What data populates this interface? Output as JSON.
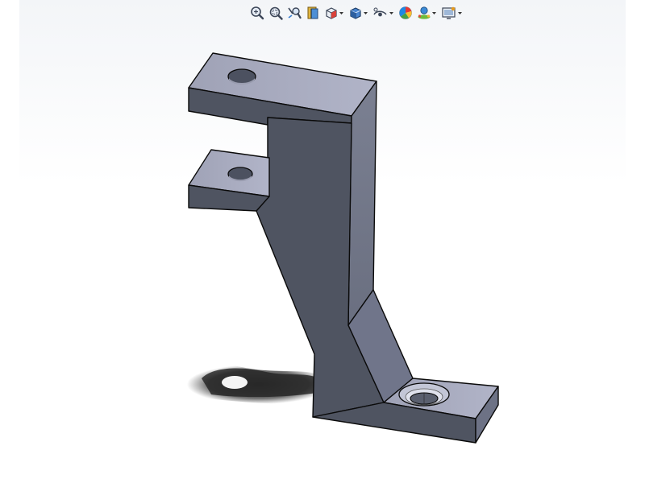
{
  "toolbar": {
    "tools": [
      {
        "icon": "zoom-to-fit-icon",
        "has_dropdown": false
      },
      {
        "icon": "zoom-to-area-icon",
        "has_dropdown": false
      },
      {
        "icon": "previous-view-icon",
        "has_dropdown": false
      },
      {
        "icon": "section-view-icon",
        "has_dropdown": false
      },
      {
        "icon": "view-orientation-icon",
        "has_dropdown": true
      },
      {
        "icon": "display-style-icon",
        "has_dropdown": true
      },
      {
        "icon": "hide-show-items-icon",
        "has_dropdown": true
      },
      {
        "icon": "edit-appearance-icon",
        "has_dropdown": false
      },
      {
        "icon": "apply-scene-icon",
        "has_dropdown": true
      },
      {
        "icon": "view-settings-icon",
        "has_dropdown": true
      }
    ]
  },
  "colors": {
    "part_face_dark": "#4f5461",
    "part_face_mid": "#727786",
    "part_face_light": "#a3a6b9",
    "part_edge": "#0a0a0a",
    "viewport_bg_top": "#f3f5f8",
    "viewport_bg_bottom": "#ffffff",
    "shadow": "#1e1e1e"
  }
}
